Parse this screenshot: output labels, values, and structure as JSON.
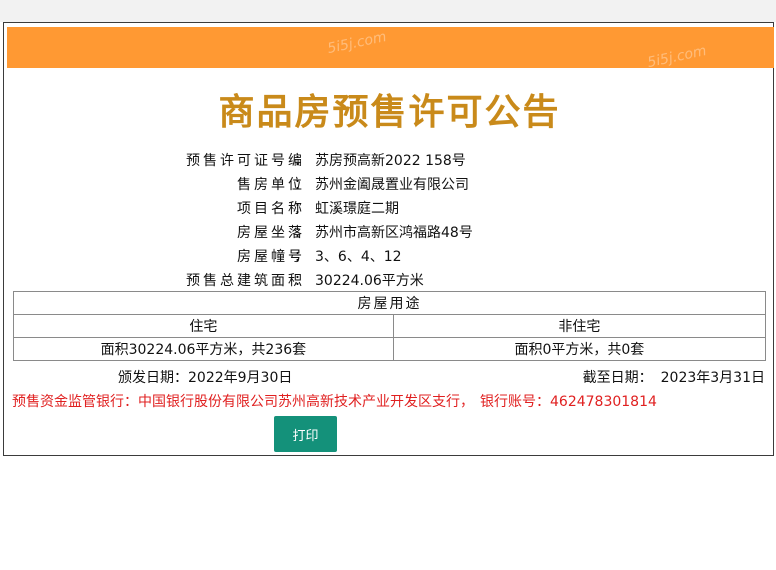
{
  "watermark": [
    "5i5j.com",
    "5i5j.com"
  ],
  "title": "商品房预售许可公告",
  "info": [
    {
      "label": "预售许可证号编",
      "value": "苏房预高新2022 158号"
    },
    {
      "label": "售房单位",
      "value": "苏州金阖晟置业有限公司"
    },
    {
      "label": "项目名称",
      "value": "虹溪璟庭二期"
    },
    {
      "label": "房屋坐落",
      "value": "苏州市高新区鸿福路48号"
    },
    {
      "label": "房屋幢号",
      "value": "3、6、4、12"
    },
    {
      "label": "预售总建筑面积",
      "value": "30224.06平方米"
    }
  ],
  "usage": {
    "header": "房屋用途",
    "columns": [
      "住宅",
      "非住宅"
    ],
    "values": [
      "面积30224.06平方米，共236套",
      "面积0平方米，共0套"
    ]
  },
  "dates": {
    "issue_label": "颁发日期：",
    "issue_date": "2022年9月30日",
    "expiry_label": "截至日期：",
    "expiry_date": "2023年3月31日"
  },
  "bank": {
    "label": "预售资金监管银行：",
    "name": "中国银行股份有限公司苏州高新技术产业开发区支行，",
    "account_label": "银行账号：",
    "account": "462478301814"
  },
  "print_label": "打印",
  "colors": {
    "orange_bar": "#ff9933",
    "title": "#c98a1a",
    "bank_text": "#e02020",
    "button": "#14917a"
  }
}
